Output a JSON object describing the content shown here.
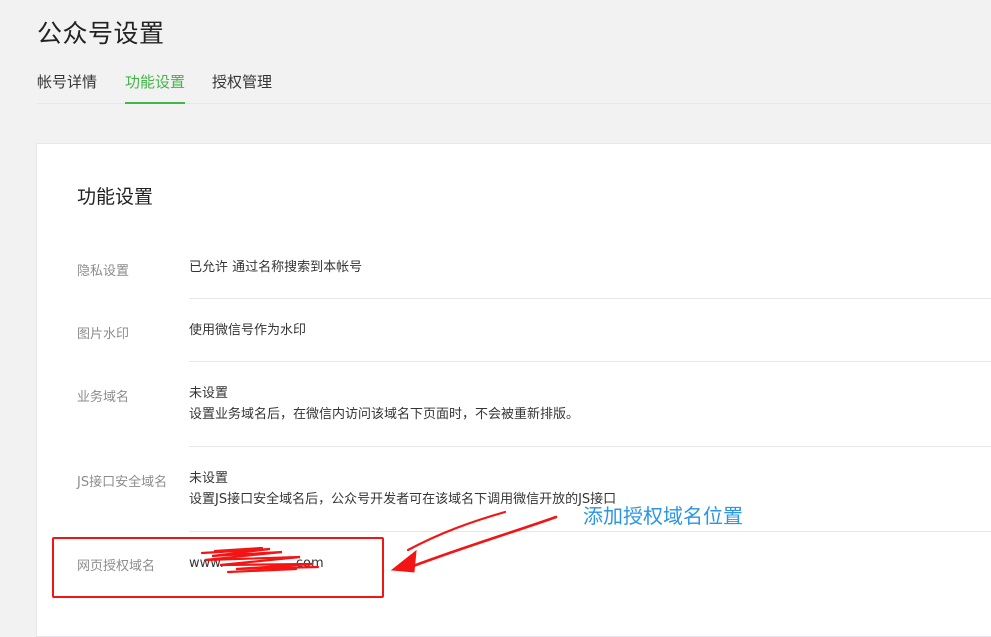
{
  "page": {
    "title": "公众号设置"
  },
  "tabs": [
    {
      "label": "帐号详情",
      "active": false
    },
    {
      "label": "功能设置",
      "active": true
    },
    {
      "label": "授权管理",
      "active": false
    }
  ],
  "card": {
    "title": "功能设置",
    "rows": [
      {
        "label": "隐私设置",
        "value": "已允许 通过名称搜索到本帐号"
      },
      {
        "label": "图片水印",
        "value": "使用微信号作为水印"
      },
      {
        "label": "业务域名",
        "value": "未设置",
        "desc": "设置业务域名后，在微信内访问该域名下页面时，不会被重新排版。"
      },
      {
        "label": "JS接口安全域名",
        "value": "未设置",
        "desc": "设置JS接口安全域名后，公众号开发者可在该域名下调用微信开放的JS接口"
      },
      {
        "label": "网页授权域名",
        "value": "www.",
        "value_suffix": "com"
      }
    ]
  },
  "annotation": {
    "text": "添加授权域名位置",
    "color": "#2b95e6",
    "box_color": "#f31414"
  },
  "colors": {
    "accent": "#44b549",
    "annotation_red": "#f31414"
  }
}
